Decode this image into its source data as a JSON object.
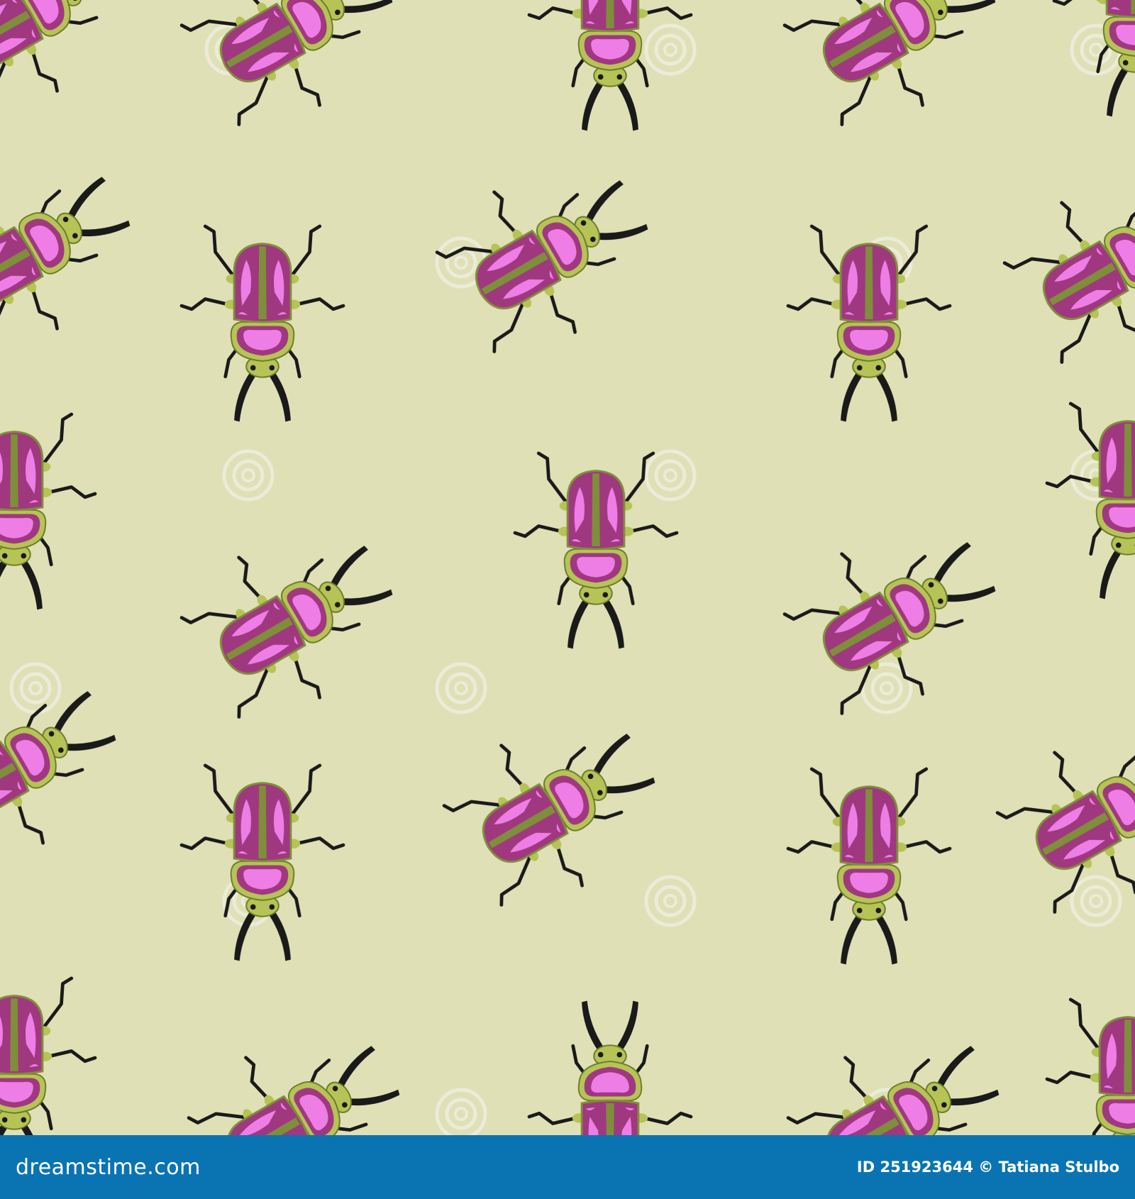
{
  "background_color": "#dfe0b6",
  "footer": {
    "bg_color": "#0a74b3",
    "site": "dreamstime.com",
    "credit": "ID 251923644 © Tatiana Stulbo"
  },
  "watermark": {
    "text": "dreamstime",
    "icon": "spiral-logo-icon"
  },
  "beetle": {
    "shell_color": "#a0387f",
    "highlight_color": "#ee7ee6",
    "body_color": "#b6c356",
    "stripe_color": "#7f8e3a",
    "leg_color": "#1a1a1a"
  }
}
